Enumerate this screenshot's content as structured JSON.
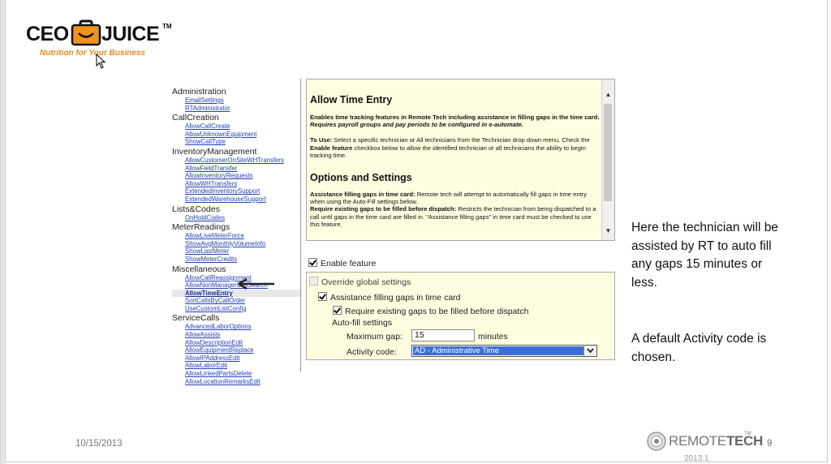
{
  "logo": {
    "ceo": "CEO",
    "juice": "JUICE",
    "tm": "TM",
    "tagline": "Nutrition for Your Business"
  },
  "tree": {
    "groups": [
      {
        "label": "Administration",
        "items": [
          "EmailSettings",
          "RTAdministrator"
        ]
      },
      {
        "label": "CallCreation",
        "items": [
          "AllowCallCreate",
          "AllowUnknownEquipment",
          "ShowCallType"
        ]
      },
      {
        "label": "InventoryManagement",
        "items": [
          "AllowCustomerOnSiteWHTransfers",
          "AllowFieldTransfer",
          "AllowInventoryRequests",
          "AllowWHTransfers",
          "ExtendedInventorySupport",
          "ExtendedWarehouseSupport"
        ]
      },
      {
        "label": "Lists&Codes",
        "items": [
          "OnHoldCodes"
        ]
      },
      {
        "label": "MeterReadings",
        "items": [
          "AllowLiveMeterForce",
          "ShowAvgMonthlyVolumeInfo",
          "ShowLastMeter",
          "ShowMeterCredits"
        ]
      },
      {
        "label": "Miscellaneous",
        "items": [
          "AllowCallReassignment",
          "AllowNonManagerCallSearch",
          "AllowTimeEntry",
          "SortCallsByCallOrder",
          "UseCustomListConfig"
        ]
      },
      {
        "label": "ServiceCalls",
        "items": [
          "AdvancedLaborOptions",
          "AllowAssists",
          "AllowDescriptionEdit",
          "AllowEquipmentReplace",
          "AllowIPAddressEdit",
          "AllowLaborEdit",
          "AllowLinkedPartsDelete",
          "AllowLocationRemarksEdit"
        ]
      }
    ],
    "selected": "AllowTimeEntry"
  },
  "help": {
    "title": "Allow Time Entry",
    "intro_bold": "Enables time tracking features in Remote Tech including assistance in filling gaps in the time card.",
    "intro_italic": "Requires payroll groups and pay periods to be configured in e-automate.",
    "touse_label": "To Use:",
    "touse_text1": "Select a specific technician or All technicians from the Technician drop down menu. Check the",
    "touse_bold": "Enable feature",
    "touse_text2": "checkbox below to allow the identified technician or all technicians the ability to begin tracking time.",
    "options_title": "Options and Settings",
    "opt1_label": "Assistance filling gaps in time card:",
    "opt1_text": "Remote tech will attempt to automatically fill gaps in time entry when using the Auto-Fill settings below.",
    "opt2_label": "Require existing gaps to be filled before dispatch:",
    "opt2_text": "Restricts the technician from being dispatched to a call until gaps in the time card are filled in. \"Assistance filling gaps\" in time card must be checked to use this feature."
  },
  "settings": {
    "enable_feature": "Enable feature",
    "override_global": "Override global settings",
    "assist_gaps": "Assistance filling gaps in time card",
    "require_gaps": "Require existing gaps to be filled before dispatch",
    "autofill_label": "Auto-fill settings",
    "max_gap_label": "Maximum gap:",
    "max_gap_value": "15",
    "max_gap_unit": "minutes",
    "activity_label": "Activity code:",
    "activity_value": "AD - Administrative Time"
  },
  "notes": {
    "note1": "Here the technician will be assisted by RT to auto fill any gaps 15 minutes or less.",
    "note2": "A default Activity code is chosen."
  },
  "footer": {
    "date": "10/15/2013",
    "brand_a": "REMOTE",
    "brand_b": "TECH",
    "brand_tm": "TM",
    "page": "9",
    "year": "2013.1"
  },
  "colors": {
    "accent_orange": "#e8891f",
    "link_blue": "#2341b8",
    "panel_yellow": "#fffde0",
    "select_blue": "#3a6fd8"
  }
}
